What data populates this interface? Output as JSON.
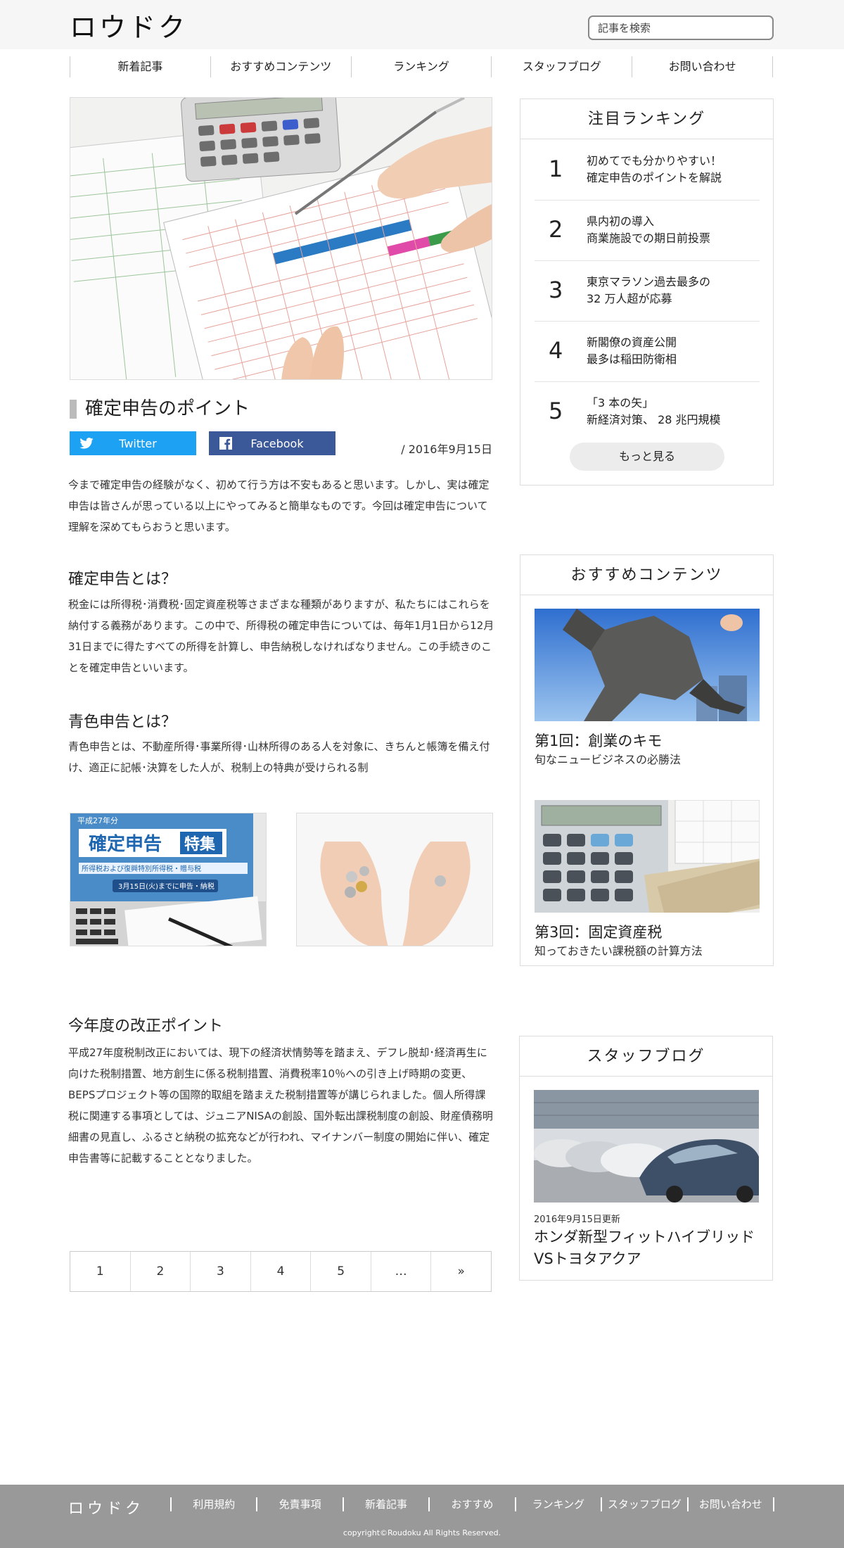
{
  "header": {
    "logo": "ロウドク",
    "search_placeholder": "記事を検索"
  },
  "nav": {
    "items": [
      "新着記事",
      "おすすめコンテンツ",
      "ランキング",
      "スタッフブログ",
      "お問い合わせ"
    ]
  },
  "article": {
    "title": "確定申告のポイント",
    "share": {
      "twitter": "Twitter",
      "facebook": "Facebook"
    },
    "date": "/ 2016年9月15日",
    "intro": "今まで確定申告の経験がなく、初めて行う方は不安もあると思います。しかし、実は確定申告は皆さんが思っている以上にやってみると簡単なものです。今回は確定申告について理解を深めてもらおうと思います。",
    "sections": [
      {
        "heading": "確定申告とは？",
        "body": "税金には所得税･消費税･固定資産税等さまざまな種類がありますが、私たちにはこれらを納付する義務があります。この中で、所得税の確定申告については、毎年1月1日から12月31日までに得たすべての所得を計算し、申告納税しなければなりません。この手続きのことを確定申告といいます。"
      },
      {
        "heading": "青色申告とは？",
        "body": "青色申告とは、不動産所得･事業所得･山林所得のある人を対象に、きちんと帳簿を備え付け、適正に記帳･決算をした人が、税制上の特典が受けられる制"
      },
      {
        "heading": "今年度の改正ポイント",
        "body": "平成27年度税制改正においては、現下の経済状情勢等を踏まえ、デフレ脱却･経済再生に向けた税制措置、地方創生に係る税制措置、消費税率10％への引き上げ時期の変更、BEPSプロジェクト等の国際的取組を踏まえた税制措置等が講じられました。個人所得課税に関連する事項としては、ジュニアNISAの創設、国外転出課税制度の創設、財産債務明細書の見直し、ふるさと納税の拡充などが行われ、マイナンバー制度の開始に伴い、確定申告書等に記載することとなりました。"
      }
    ],
    "photo_text": {
      "line1": "平成27年分",
      "line2": "確定申告",
      "line2_highlight": "特集",
      "line3": "所得税および復興特別所得税・贈与税",
      "line4": "3月15日(火)までに申告・納税"
    }
  },
  "pager": {
    "items": [
      "1",
      "2",
      "3",
      "4",
      "5",
      "…",
      "»"
    ]
  },
  "ranking": {
    "title": "注目ランキング",
    "items": [
      {
        "num": "1",
        "line1": "初めてでも分かりやすい！",
        "line2": "確定申告のポイントを解説"
      },
      {
        "num": "2",
        "line1": "県内初の導入",
        "line2": "商業施設での期日前投票"
      },
      {
        "num": "3",
        "line1": "東京マラソン過去最多の",
        "line2": "32 万人超が応募"
      },
      {
        "num": "4",
        "line1": "新閣僚の資産公開",
        "line2": "最多は稲田防衛相"
      },
      {
        "num": "5",
        "line1": "「3 本の矢」",
        "line2": "新経済対策、 28 兆円規模"
      }
    ],
    "more": "もっと見る"
  },
  "recommend": {
    "title": "おすすめコンテンツ",
    "items": [
      {
        "title": "第1回：創業のキモ",
        "sub": "旬なニュービジネスの必勝法"
      },
      {
        "title": "第3回：固定資産税",
        "sub": "知っておきたい課税額の計算方法"
      }
    ]
  },
  "staff_blog": {
    "title": "スタッフブログ",
    "date": "2016年9月15日更新",
    "headline1": "ホンダ新型フィットハイブリッド",
    "headline2": "VSトヨタアクア"
  },
  "footer": {
    "logo": "ロウドク",
    "nav": [
      "利用規約",
      "免責事項",
      "新着記事",
      "おすすめ",
      "ランキング",
      "スタッフブログ",
      "お問い合わせ"
    ],
    "copyright": "copyright©Roudoku All Rights Reserved."
  },
  "colors": {
    "twitter": "#1da1f2",
    "facebook": "#3b5998",
    "footer_bg": "#999999",
    "header_bg": "#f6f6f6"
  }
}
